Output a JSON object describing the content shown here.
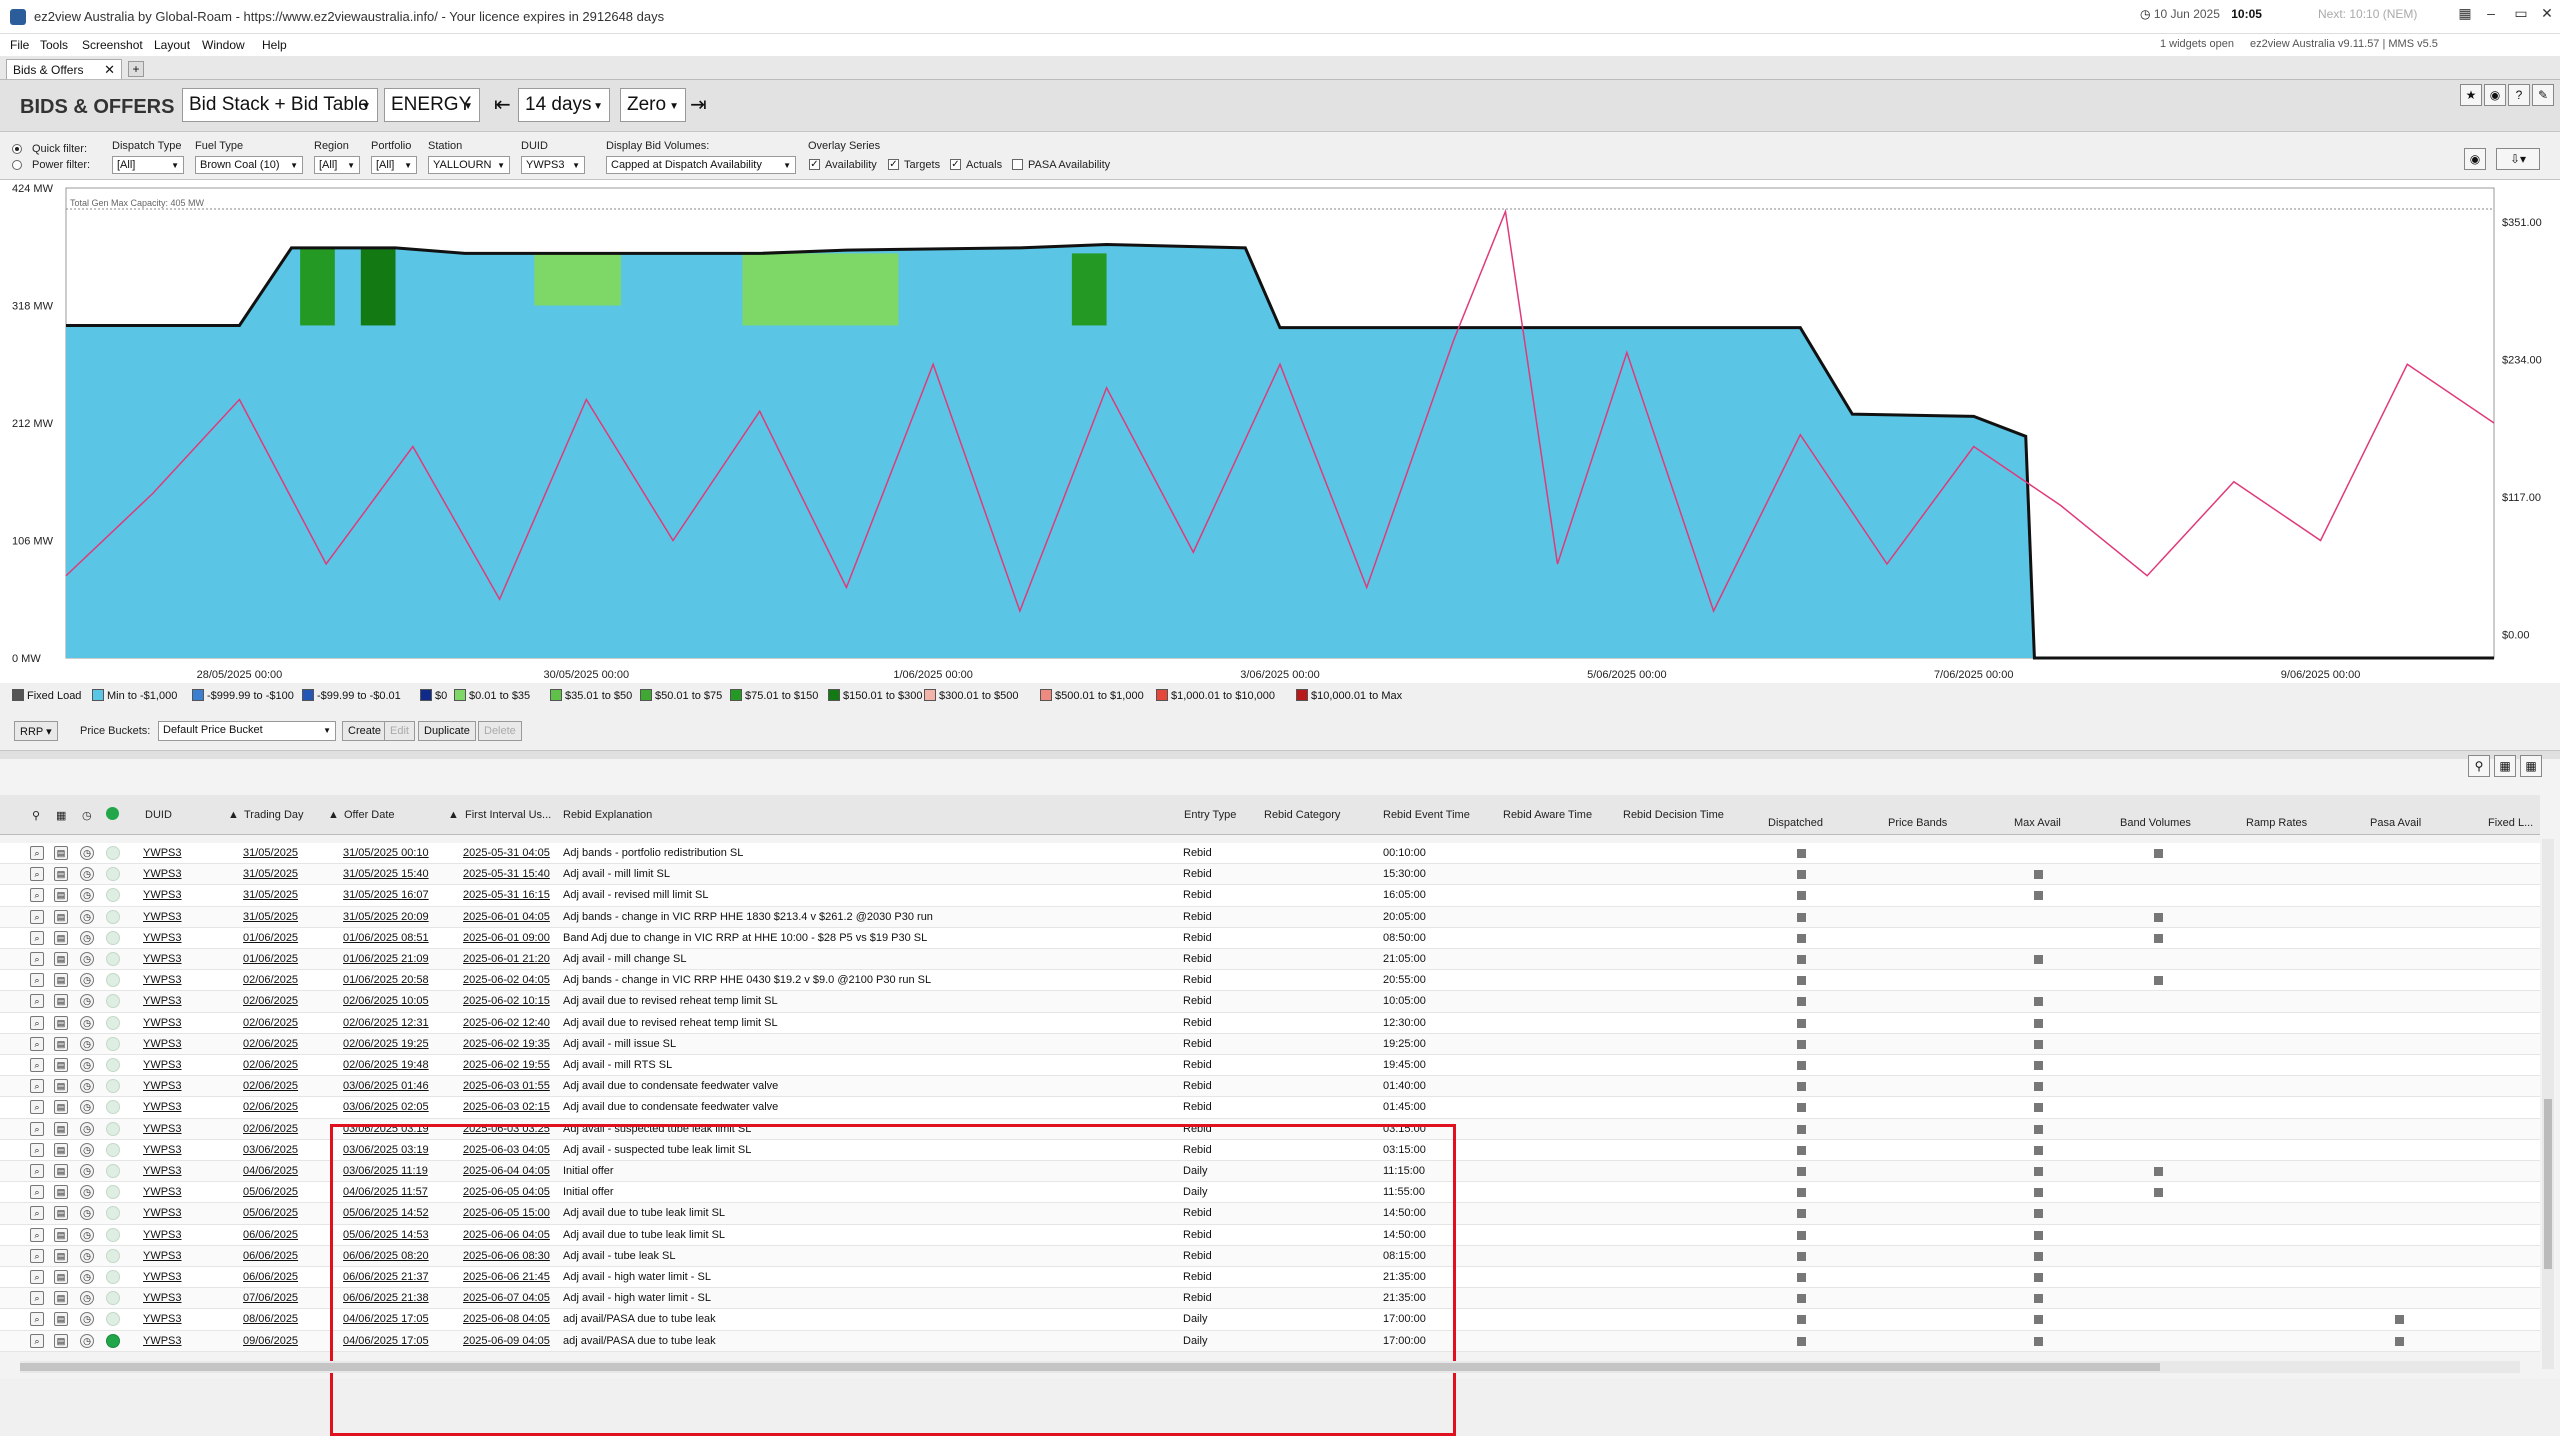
{
  "window": {
    "title": "ez2view Australia by Global-Roam - https://www.ez2viewaustralia.info/ - Your licence expires in 2912648 days",
    "date": "10 Jun 2025",
    "time": "10:05",
    "next": "Next: 10:10 (NEM)"
  },
  "menu": [
    "File",
    "Tools",
    "Screenshot",
    "Layout",
    "Window",
    "Help"
  ],
  "status": {
    "widgets": "1 widgets open",
    "version": "ez2view Australia v9.11.57 | MMS v5.5"
  },
  "tab": {
    "label": "Bids & Offers"
  },
  "toolbar": {
    "heading": "BIDS & OFFERS",
    "view": "Bid Stack + Bid Table",
    "market": "ENERGY",
    "range": "14 days",
    "baseline": "Zero"
  },
  "filters": {
    "quick_filter": "Quick filter:",
    "power_filter": "Power filter:",
    "dispatch_type_label": "Dispatch Type",
    "dispatch_type": "[All]",
    "fuel_type_label": "Fuel Type",
    "fuel_type": "Brown Coal (10)",
    "region_label": "Region",
    "region": "[All]",
    "portfolio_label": "Portfolio",
    "portfolio": "[All]",
    "station_label": "Station",
    "station": "YALLOURN",
    "duid_label": "DUID",
    "duid": "YWPS3",
    "display_label": "Display Bid Volumes:",
    "display": "Capped at Dispatch Availability",
    "overlay_label": "Overlay Series",
    "availability": "Availability",
    "targets": "Targets",
    "actuals": "Actuals",
    "pasa": "PASA Availability"
  },
  "chart_data": {
    "type": "area",
    "title": "",
    "annotation": "Total Gen Max Capacity: 405 MW",
    "y_left_ticks": [
      "424 MW",
      "318 MW",
      "212 MW",
      "106 MW",
      "0 MW"
    ],
    "y_right_ticks": [
      "$351.00",
      "$234.00",
      "$117.00",
      "$0.00"
    ],
    "x_ticks": [
      "28/05/2025 00:00",
      "30/05/2025 00:00",
      "1/06/2025 00:00",
      "3/06/2025 00:00",
      "5/06/2025 00:00",
      "7/06/2025 00:00",
      "9/06/2025 00:00"
    ],
    "ylim_mw": [
      0,
      424
    ],
    "ylim_price": [
      -20,
      380
    ],
    "max_capacity_mw": 405,
    "availability_mw": [
      {
        "day": 27.0,
        "mw": 300
      },
      {
        "day": 28.0,
        "mw": 300
      },
      {
        "day": 28.3,
        "mw": 370
      },
      {
        "day": 28.9,
        "mw": 370
      },
      {
        "day": 29.3,
        "mw": 365
      },
      {
        "day": 30.0,
        "mw": 365
      },
      {
        "day": 31.0,
        "mw": 365
      },
      {
        "day": 31.5,
        "mw": 368
      },
      {
        "day": 32.5,
        "mw": 370
      },
      {
        "day": 33.0,
        "mw": 373
      },
      {
        "day": 33.8,
        "mw": 370
      },
      {
        "day": 34.0,
        "mw": 298
      },
      {
        "day": 35.5,
        "mw": 298
      },
      {
        "day": 36.1,
        "mw": 298
      },
      {
        "day": 37.0,
        "mw": 298
      },
      {
        "day": 37.3,
        "mw": 220
      },
      {
        "day": 38.0,
        "mw": 218
      },
      {
        "day": 38.3,
        "mw": 200
      },
      {
        "day": 38.35,
        "mw": 0
      },
      {
        "day": 41.0,
        "mw": 0
      }
    ],
    "green_band_periods": [
      {
        "start_day": 28.35,
        "end_day": 28.55,
        "mw_from": 300,
        "mw_to": 370,
        "band": "$75.01 to $150"
      },
      {
        "start_day": 28.7,
        "end_day": 28.9,
        "mw_from": 300,
        "mw_to": 370,
        "band": "$150.01 to $300"
      },
      {
        "start_day": 29.7,
        "end_day": 30.2,
        "mw_from": 318,
        "mw_to": 365,
        "band": "$0.01 to $35"
      },
      {
        "start_day": 30.9,
        "end_day": 31.8,
        "mw_from": 300,
        "mw_to": 365,
        "band": "$0.01 to $35"
      },
      {
        "start_day": 32.8,
        "end_day": 33.0,
        "mw_from": 300,
        "mw_to": 365,
        "band": "$75.01 to $150"
      }
    ],
    "rrp_series_name": "RRP",
    "rrp_price_daily": [
      {
        "day": 27.0,
        "price": 50
      },
      {
        "day": 27.5,
        "price": 120
      },
      {
        "day": 28.0,
        "price": 200
      },
      {
        "day": 28.5,
        "price": 60
      },
      {
        "day": 29.0,
        "price": 160
      },
      {
        "day": 29.5,
        "price": 30
      },
      {
        "day": 30.0,
        "price": 200
      },
      {
        "day": 30.5,
        "price": 80
      },
      {
        "day": 31.0,
        "price": 190
      },
      {
        "day": 31.5,
        "price": 40
      },
      {
        "day": 32.0,
        "price": 230
      },
      {
        "day": 32.5,
        "price": 20
      },
      {
        "day": 33.0,
        "price": 210
      },
      {
        "day": 33.5,
        "price": 70
      },
      {
        "day": 34.0,
        "price": 230
      },
      {
        "day": 34.5,
        "price": 40
      },
      {
        "day": 35.0,
        "price": 250
      },
      {
        "day": 35.3,
        "price": 360
      },
      {
        "day": 35.6,
        "price": 60
      },
      {
        "day": 36.0,
        "price": 240
      },
      {
        "day": 36.5,
        "price": 20
      },
      {
        "day": 37.0,
        "price": 170
      },
      {
        "day": 37.5,
        "price": 60
      },
      {
        "day": 38.0,
        "price": 160
      },
      {
        "day": 38.5,
        "price": 110
      },
      {
        "day": 39.0,
        "price": 50
      },
      {
        "day": 39.5,
        "price": 130
      },
      {
        "day": 40.0,
        "price": 80
      },
      {
        "day": 40.5,
        "price": 230
      },
      {
        "day": 41.0,
        "price": 180
      }
    ]
  },
  "legend": [
    {
      "label": "Fixed Load",
      "color": "#555555"
    },
    {
      "label": "Min to -$1,000",
      "color": "#5bc5e5"
    },
    {
      "label": "-$999.99 to -$100",
      "color": "#3a7fd0"
    },
    {
      "label": "-$99.99 to -$0.01",
      "color": "#2356b5"
    },
    {
      "label": "$0",
      "color": "#102a8a"
    },
    {
      "label": "$0.01 to $35",
      "color": "#7ed867"
    },
    {
      "label": "$35.01 to $50",
      "color": "#5fc04a"
    },
    {
      "label": "$50.01 to $75",
      "color": "#3fa832"
    },
    {
      "label": "$75.01 to $150",
      "color": "#249a24"
    },
    {
      "label": "$150.01 to $300",
      "color": "#137a13"
    },
    {
      "label": "$300.01 to $500",
      "color": "#f3b3a8"
    },
    {
      "label": "$500.01 to $1,000",
      "color": "#ef8a80"
    },
    {
      "label": "$1,000.01 to $10,000",
      "color": "#e5483a"
    },
    {
      "label": "$10,000.01 to Max",
      "color": "#b81a1a"
    }
  ],
  "price_controls": {
    "rrp": "RRP",
    "buckets_label": "Price Buckets:",
    "bucket": "Default Price Bucket",
    "create": "Create",
    "edit": "Edit",
    "duplicate": "Duplicate",
    "delete": "Delete"
  },
  "table": {
    "headers": {
      "duid": "DUID",
      "trading_day": "Trading Day",
      "offer_date": "Offer Date",
      "first_interval": "First Interval Us...",
      "explanation": "Rebid Explanation",
      "entry_type": "Entry Type",
      "category": "Rebid Category",
      "event_time": "Rebid Event Time",
      "aware_time": "Rebid Aware Time",
      "decision_time": "Rebid Decision Time",
      "dispatched": "Dispatched",
      "price_bands": "Price Bands",
      "max_avail": "Max Avail",
      "band_volumes": "Band Volumes",
      "ramp_rates": "Ramp Rates",
      "pasa_avail": "Pasa Avail",
      "fixed_load": "Fixed L..."
    },
    "rows": [
      {
        "duid": "YWPS3",
        "td": "31/05/2025",
        "od": "31/05/2025 00:10",
        "fi": "2025-05-31 04:05",
        "ex": "Adj bands - portfolio redistribution SL",
        "et": "Rebid",
        "ev": "00:10:00",
        "ma": false,
        "bv": true,
        "pa": false
      },
      {
        "duid": "YWPS3",
        "td": "31/05/2025",
        "od": "31/05/2025 15:40",
        "fi": "2025-05-31 15:40",
        "ex": "Adj avail - mill limit SL",
        "et": "Rebid",
        "ev": "15:30:00",
        "ma": true,
        "bv": false,
        "pa": false
      },
      {
        "duid": "YWPS3",
        "td": "31/05/2025",
        "od": "31/05/2025 16:07",
        "fi": "2025-05-31 16:15",
        "ex": "Adj avail - revised mill limit SL",
        "et": "Rebid",
        "ev": "16:05:00",
        "ma": true,
        "bv": false,
        "pa": false
      },
      {
        "duid": "YWPS3",
        "td": "31/05/2025",
        "od": "31/05/2025 20:09",
        "fi": "2025-06-01 04:05",
        "ex": "Adj bands - change in VIC RRP HHE 1830 $213.4 v $261.2 @2030 P30 run",
        "et": "Rebid",
        "ev": "20:05:00",
        "ma": false,
        "bv": true,
        "pa": false
      },
      {
        "duid": "YWPS3",
        "td": "01/06/2025",
        "od": "01/06/2025 08:51",
        "fi": "2025-06-01 09:00",
        "ex": "Band Adj due to change in VIC RRP at HHE 10:00 - $28 P5 vs $19 P30 SL",
        "et": "Rebid",
        "ev": "08:50:00",
        "ma": false,
        "bv": true,
        "pa": false
      },
      {
        "duid": "YWPS3",
        "td": "01/06/2025",
        "od": "01/06/2025 21:09",
        "fi": "2025-06-01 21:20",
        "ex": "Adj avail - mill change SL",
        "et": "Rebid",
        "ev": "21:05:00",
        "ma": true,
        "bv": false,
        "pa": false
      },
      {
        "duid": "YWPS3",
        "td": "02/06/2025",
        "od": "01/06/2025 20:58",
        "fi": "2025-06-02 04:05",
        "ex": "Adj bands - change in VIC RRP HHE 0430 $19.2 v $9.0 @2100 P30 run SL",
        "et": "Rebid",
        "ev": "20:55:00",
        "ma": false,
        "bv": true,
        "pa": false
      },
      {
        "duid": "YWPS3",
        "td": "02/06/2025",
        "od": "02/06/2025 10:05",
        "fi": "2025-06-02 10:15",
        "ex": "Adj avail due to revised reheat temp limit SL",
        "et": "Rebid",
        "ev": "10:05:00",
        "ma": true,
        "bv": false,
        "pa": false
      },
      {
        "duid": "YWPS3",
        "td": "02/06/2025",
        "od": "02/06/2025 12:31",
        "fi": "2025-06-02 12:40",
        "ex": "Adj avail due to revised reheat temp limit SL",
        "et": "Rebid",
        "ev": "12:30:00",
        "ma": true,
        "bv": false,
        "pa": false
      },
      {
        "duid": "YWPS3",
        "td": "02/06/2025",
        "od": "02/06/2025 19:25",
        "fi": "2025-06-02 19:35",
        "ex": "Adj avail - mill issue SL",
        "et": "Rebid",
        "ev": "19:25:00",
        "ma": true,
        "bv": false,
        "pa": false
      },
      {
        "duid": "YWPS3",
        "td": "02/06/2025",
        "od": "02/06/2025 19:48",
        "fi": "2025-06-02 19:55",
        "ex": "Adj avail - mill RTS SL",
        "et": "Rebid",
        "ev": "19:45:00",
        "ma": true,
        "bv": false,
        "pa": false
      },
      {
        "duid": "YWPS3",
        "td": "02/06/2025",
        "od": "03/06/2025 01:46",
        "fi": "2025-06-03 01:55",
        "ex": "Adj avail due to condensate feedwater valve",
        "et": "Rebid",
        "ev": "01:40:00",
        "ma": true,
        "bv": false,
        "pa": false
      },
      {
        "duid": "YWPS3",
        "td": "02/06/2025",
        "od": "03/06/2025 02:05",
        "fi": "2025-06-03 02:15",
        "ex": "Adj avail due to condensate feedwater valve",
        "et": "Rebid",
        "ev": "01:45:00",
        "ma": true,
        "bv": false,
        "pa": false
      },
      {
        "duid": "YWPS3",
        "td": "02/06/2025",
        "od": "03/06/2025 03:19",
        "fi": "2025-06-03 03:25",
        "ex": "Adj avail - suspected tube leak limit SL",
        "et": "Rebid",
        "ev": "03:15:00",
        "ma": true,
        "bv": false,
        "pa": false
      },
      {
        "duid": "YWPS3",
        "td": "03/06/2025",
        "od": "03/06/2025 03:19",
        "fi": "2025-06-03 04:05",
        "ex": "Adj avail - suspected tube leak limit SL",
        "et": "Rebid",
        "ev": "03:15:00",
        "ma": true,
        "bv": false,
        "pa": false
      },
      {
        "duid": "YWPS3",
        "td": "04/06/2025",
        "od": "03/06/2025 11:19",
        "fi": "2025-06-04 04:05",
        "ex": "Initial offer",
        "et": "Daily",
        "ev": "11:15:00",
        "ma": true,
        "bv": true,
        "pa": false
      },
      {
        "duid": "YWPS3",
        "td": "05/06/2025",
        "od": "04/06/2025 11:57",
        "fi": "2025-06-05 04:05",
        "ex": "Initial offer",
        "et": "Daily",
        "ev": "11:55:00",
        "ma": true,
        "bv": true,
        "pa": false
      },
      {
        "duid": "YWPS3",
        "td": "05/06/2025",
        "od": "05/06/2025 14:52",
        "fi": "2025-06-05 15:00",
        "ex": "Adj avail due to tube leak limit SL",
        "et": "Rebid",
        "ev": "14:50:00",
        "ma": true,
        "bv": false,
        "pa": false
      },
      {
        "duid": "YWPS3",
        "td": "06/06/2025",
        "od": "05/06/2025 14:53",
        "fi": "2025-06-06 04:05",
        "ex": "Adj avail due to tube leak limit SL",
        "et": "Rebid",
        "ev": "14:50:00",
        "ma": true,
        "bv": false,
        "pa": false
      },
      {
        "duid": "YWPS3",
        "td": "06/06/2025",
        "od": "06/06/2025 08:20",
        "fi": "2025-06-06 08:30",
        "ex": "Adj avail - tube leak SL",
        "et": "Rebid",
        "ev": "08:15:00",
        "ma": true,
        "bv": false,
        "pa": false
      },
      {
        "duid": "YWPS3",
        "td": "06/06/2025",
        "od": "06/06/2025 21:37",
        "fi": "2025-06-06 21:45",
        "ex": "Adj avail - high water limit - SL",
        "et": "Rebid",
        "ev": "21:35:00",
        "ma": true,
        "bv": false,
        "pa": false
      },
      {
        "duid": "YWPS3",
        "td": "07/06/2025",
        "od": "06/06/2025 21:38",
        "fi": "2025-06-07 04:05",
        "ex": "Adj avail - high water limit - SL",
        "et": "Rebid",
        "ev": "21:35:00",
        "ma": true,
        "bv": false,
        "pa": false
      },
      {
        "duid": "YWPS3",
        "td": "08/06/2025",
        "od": "04/06/2025 17:05",
        "fi": "2025-06-08 04:05",
        "ex": "adj avail/PASA due to tube leak",
        "et": "Daily",
        "ev": "17:00:00",
        "ma": true,
        "bv": false,
        "pa": true
      },
      {
        "duid": "YWPS3",
        "td": "09/06/2025",
        "od": "04/06/2025 17:05",
        "fi": "2025-06-09 04:05",
        "ex": "adj avail/PASA due to tube leak",
        "et": "Daily",
        "ev": "17:00:00",
        "ma": true,
        "bv": false,
        "pa": true
      }
    ]
  }
}
